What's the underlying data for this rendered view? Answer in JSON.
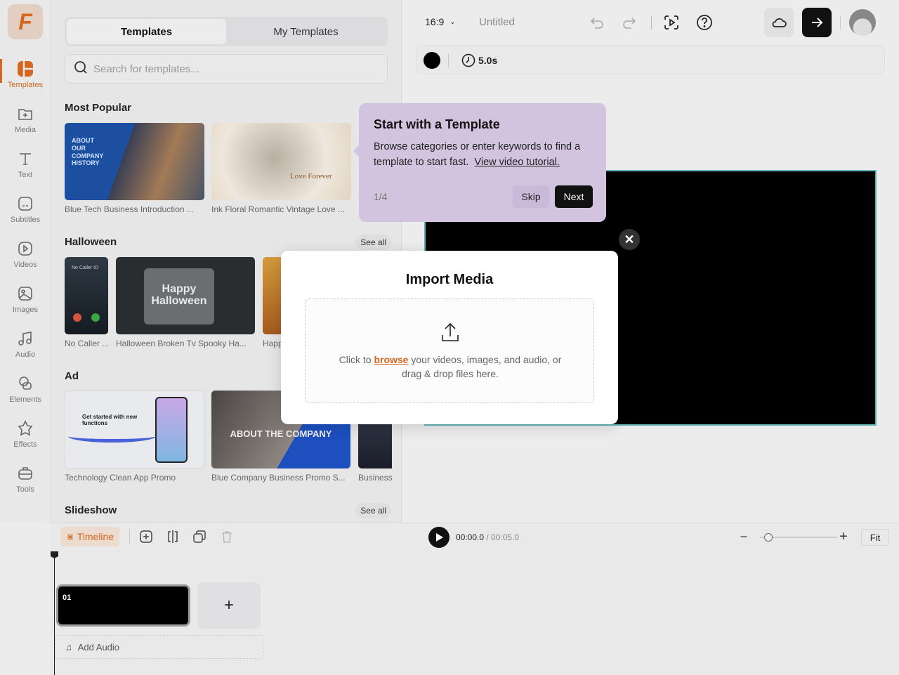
{
  "colors": {
    "accent": "#d5661f",
    "tooltip_bg": "#d2c4df",
    "canvas_border": "#5fb2b5"
  },
  "rail": {
    "logo": "F",
    "items": [
      {
        "label": "Templates",
        "icon": "templates-icon",
        "active": true
      },
      {
        "label": "Media",
        "icon": "media-icon"
      },
      {
        "label": "Text",
        "icon": "text-icon"
      },
      {
        "label": "Subtitles",
        "icon": "subtitles-icon"
      },
      {
        "label": "Videos",
        "icon": "videos-icon"
      },
      {
        "label": "Images",
        "icon": "images-icon"
      },
      {
        "label": "Audio",
        "icon": "audio-icon"
      },
      {
        "label": "Elements",
        "icon": "elements-icon"
      },
      {
        "label": "Effects",
        "icon": "effects-icon"
      },
      {
        "label": "Tools",
        "icon": "tools-icon"
      }
    ]
  },
  "panel": {
    "tabs": [
      "Templates",
      "My Templates"
    ],
    "search_placeholder": "Search for templates...",
    "see_all": "See all",
    "sections": [
      {
        "title": "Most Popular",
        "items": [
          "Blue Tech Business Introduction ...",
          "Ink Floral Romantic Vintage Love ..."
        ]
      },
      {
        "title": "Halloween",
        "items": [
          "No Caller ...",
          "Halloween Broken Tv Spooky Ha...",
          "Happ..."
        ]
      },
      {
        "title": "Ad",
        "items": [
          "Technology Clean App Promo",
          "Blue Company Business Promo S...",
          "Business"
        ]
      },
      {
        "title": "Slideshow",
        "items": []
      }
    ],
    "thumb_text": {
      "about": "ABOUT OUR COMPANY HISTORY",
      "love": "Love Forever",
      "happy": "Happy Halloween",
      "nocaller": "No Caller ID",
      "getstarted": "Get started with new functions",
      "aboutco": "ABOUT THE COMPANY"
    }
  },
  "topbar": {
    "ratio": "16:9",
    "title": "Untitled"
  },
  "subbar": {
    "duration": "5.0s"
  },
  "tooltip": {
    "title": "Start with a Template",
    "body": "Browse categories or enter keywords to find a template to start fast.",
    "link": "View video tutorial.",
    "step": "1/4",
    "skip": "Skip",
    "next": "Next"
  },
  "modal": {
    "title": "Import Media",
    "text_before": "Click to ",
    "browse": "browse",
    "text_after": " your videos, images, and audio, or drag & drop files here."
  },
  "timeline": {
    "label": "Timeline",
    "current": "00:00.0",
    "total": "/ 00:05.0",
    "fit": "Fit",
    "clip": "01",
    "add_audio": "Add Audio",
    "zoom_level": 0.05
  }
}
